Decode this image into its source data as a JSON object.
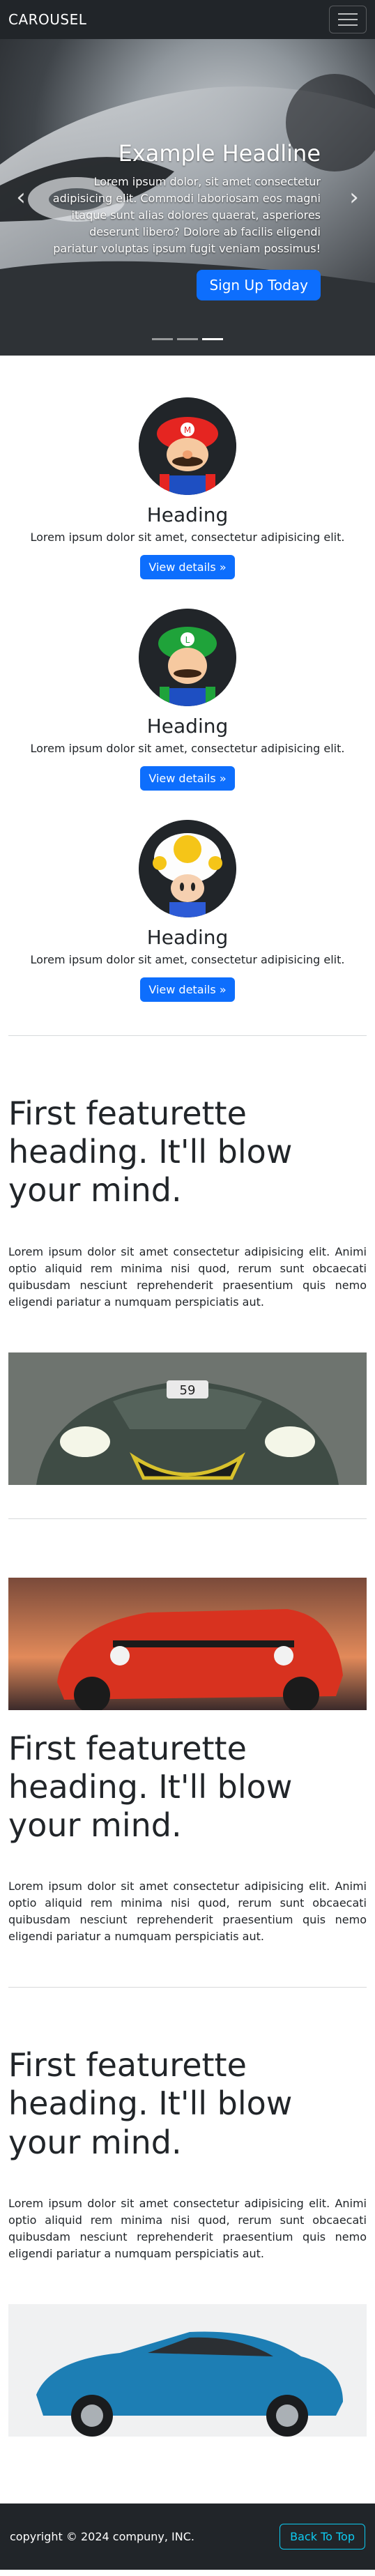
{
  "navbar": {
    "brand": "CAROUSEL"
  },
  "carousel": {
    "headline": "Example Headline",
    "text": "Lorem ipsum dolor, sit amet consectetur adipisicing elit. Commodi laboriosam eos magni itaque sunt alias dolores quaerat, asperiores deserunt libero? Dolore ab facilis eligendi pariatur voluptas ipsum fugit veniam possimus!",
    "button": "Sign Up Today",
    "prev_icon": "‹",
    "next_icon": "›",
    "active_slide": 3,
    "slide_count": 3
  },
  "marketing": [
    {
      "heading": "Heading",
      "text": "Lorem ipsum dolor sit amet, consectetur adipisicing elit.",
      "button": "View details »",
      "avatar": "mario"
    },
    {
      "heading": "Heading",
      "text": "Lorem ipsum dolor sit amet, consectetur adipisicing elit.",
      "button": "View details »",
      "avatar": "luigi"
    },
    {
      "heading": "Heading",
      "text": "Lorem ipsum dolor sit amet, consectetur adipisicing elit.",
      "button": "View details »",
      "avatar": "toad"
    }
  ],
  "featurettes": [
    {
      "heading": "First featurette heading. It'll blow your mind.",
      "text": "Lorem ipsum dolor sit amet consectetur adipisicing elit. Animi optio aliquid rem minima nisi quod, rerum sunt obcaecati quibusdam nesciunt reprehenderit praesentium quis nemo eligendi pariatur a numquam perspiciatis aut.",
      "image": "green sports car front"
    },
    {
      "heading": "First featurette heading. It'll blow your mind.",
      "text": "Lorem ipsum dolor sit amet consectetur adipisicing elit. Animi optio aliquid rem minima nisi quod, rerum sunt obcaecati quibusdam nesciunt reprehenderit praesentium quis nemo eligendi pariatur a numquam perspiciatis aut.",
      "image": "red muscle car sunset"
    },
    {
      "heading": "First featurette heading. It'll blow your mind.",
      "text": "Lorem ipsum dolor sit amet consectetur adipisicing elit. Animi optio aliquid rem minima nisi quod, rerum sunt obcaecati quibusdam nesciunt reprehenderit praesentium quis nemo eligendi pariatur a numquam perspiciatis aut.",
      "image": "blue compact car side"
    }
  ],
  "footer": {
    "copyright": "copyright © 2024 compuny, INC.",
    "back_to_top": "Back To Top"
  },
  "colors": {
    "primary": "#0d6efd",
    "dark": "#212529",
    "info": "#0dcaf0"
  }
}
